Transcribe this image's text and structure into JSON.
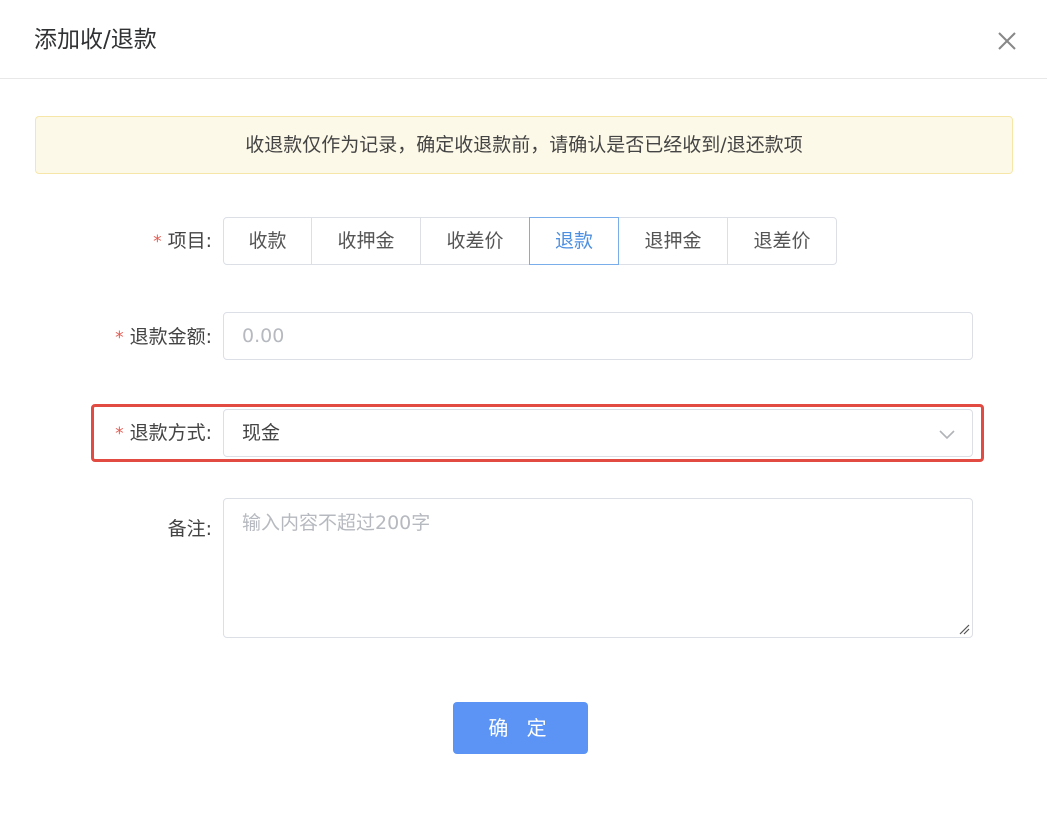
{
  "dialog": {
    "title": "添加收/退款",
    "close_icon": "close-icon"
  },
  "notice": {
    "text": "收退款仅作为记录，确定收退款前，请确认是否已经收到/退还款项",
    "background": "#fdf9e8"
  },
  "form": {
    "required_mark": "*",
    "item": {
      "label": "项目:",
      "options": [
        "收款",
        "收押金",
        "收差价",
        "退款",
        "退押金",
        "退差价"
      ],
      "selected": "退款"
    },
    "amount": {
      "label": "退款金额:",
      "placeholder": "0.00",
      "value": ""
    },
    "method": {
      "label": "退款方式:",
      "value": "现金",
      "icon": "chevron-down-icon"
    },
    "remark": {
      "label": "备注:",
      "placeholder": "输入内容不超过200字",
      "value": ""
    }
  },
  "actions": {
    "confirm_label": "确 定"
  },
  "colors": {
    "primary": "#5b94f4",
    "required": "#e55a50",
    "highlight": "#e24b42",
    "active_segment": "#4d8fe0"
  }
}
